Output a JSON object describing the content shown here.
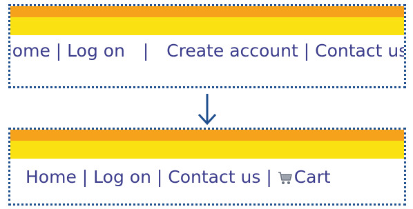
{
  "colors": {
    "border": "#1f4f8f",
    "orange": "#f7a21b",
    "yellow": "#f9e112",
    "link": "#3c3c8c",
    "arrow": "#1f4f8f"
  },
  "before": {
    "links": [
      "Home",
      "Log on",
      "Create account",
      "Contact us"
    ],
    "separator": "|"
  },
  "after": {
    "links": [
      "Home",
      "Log on",
      "Contact us",
      "Cart"
    ],
    "separator": "|",
    "cart_icon": "shopping-cart-icon"
  },
  "arrow_icon": "down-arrow-icon"
}
